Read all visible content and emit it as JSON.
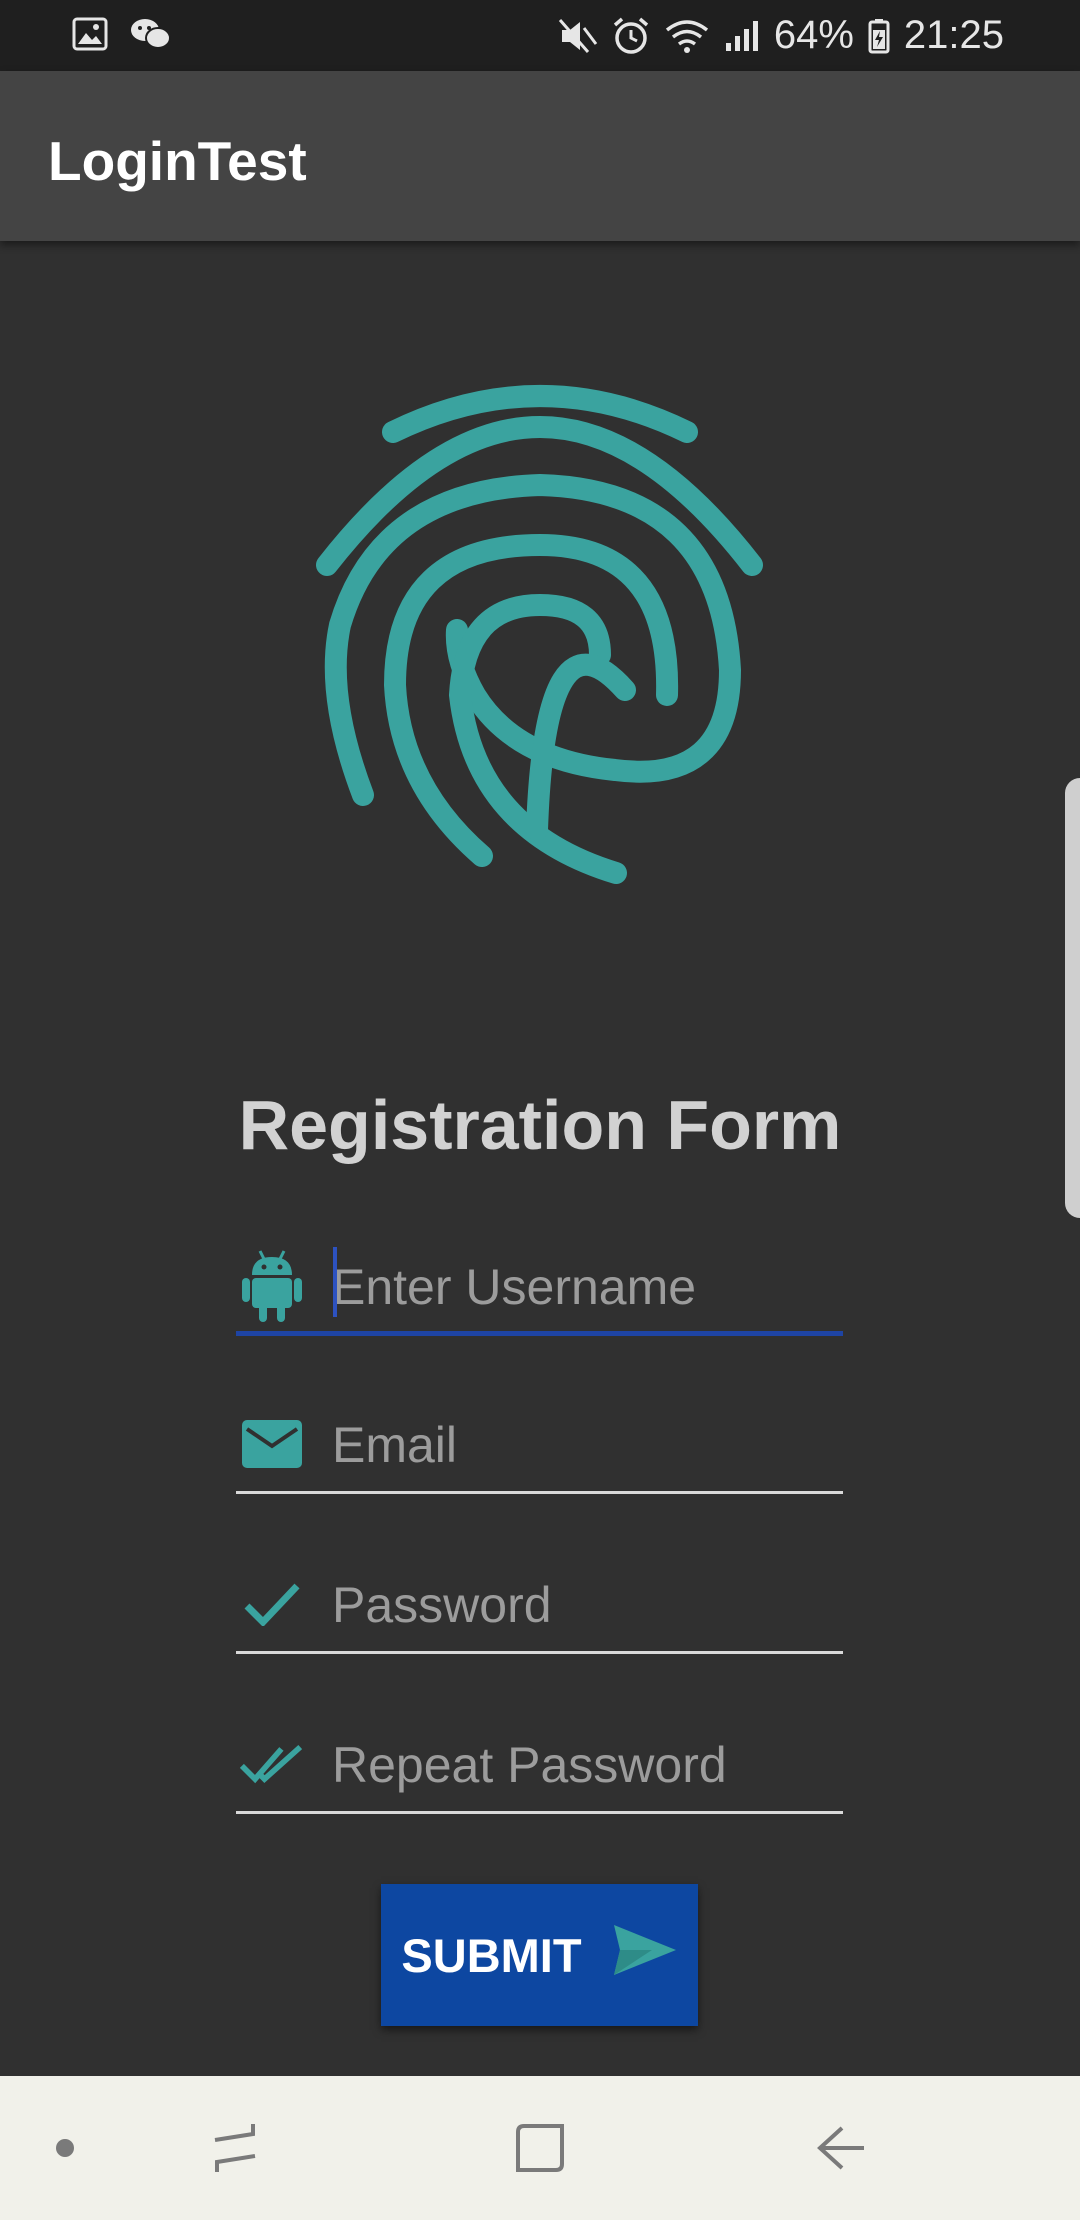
{
  "status_bar": {
    "icons_left": [
      "image-icon",
      "wechat-icon"
    ],
    "icons_right": [
      "mute-icon",
      "alarm-icon",
      "wifi-icon",
      "signal-icon"
    ],
    "battery_percent": "64%",
    "time": "21:25"
  },
  "app_bar": {
    "title": "LoginTest"
  },
  "form": {
    "title": "Registration Form",
    "fields": [
      {
        "icon": "android-icon",
        "placeholder": "Enter Username",
        "value": "",
        "focused": true
      },
      {
        "icon": "mail-icon",
        "placeholder": "Email",
        "value": ""
      },
      {
        "icon": "check-icon",
        "placeholder": "Password",
        "value": ""
      },
      {
        "icon": "double-check-icon",
        "placeholder": "Repeat Password",
        "value": ""
      }
    ],
    "submit_label": "SUBMIT",
    "submit_icon": "send-icon"
  },
  "nav_bar": {
    "buttons": [
      "dot-icon",
      "recent-apps-icon",
      "home-icon",
      "back-icon"
    ]
  },
  "colors": {
    "accent": "#3aa39f",
    "primary": "#0d47a1",
    "background": "#303030",
    "app_bar": "#444444"
  }
}
